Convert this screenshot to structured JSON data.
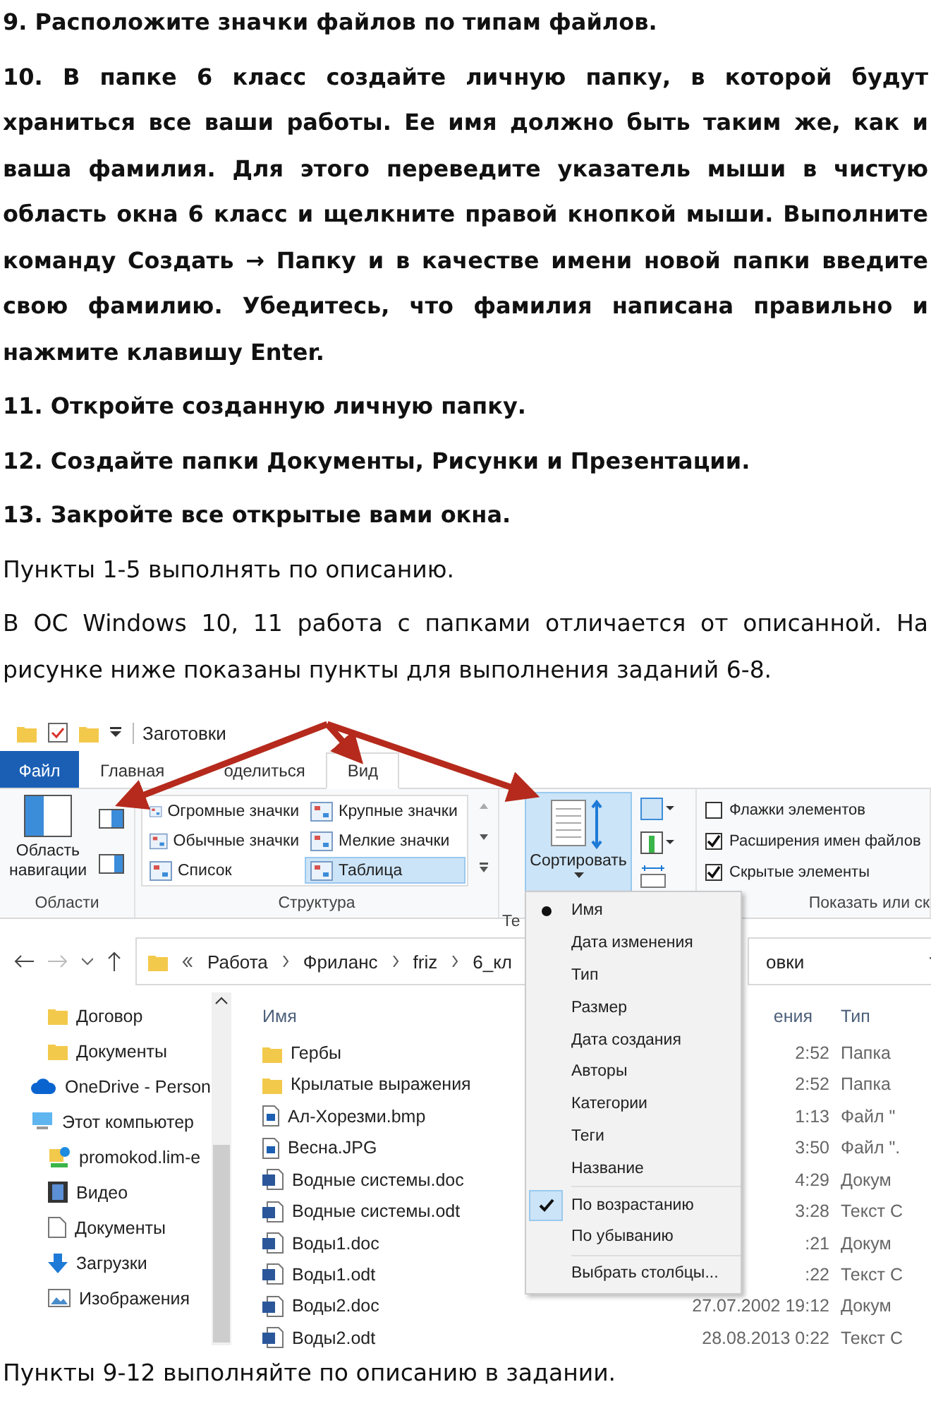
{
  "paragraphs": [
    {
      "kind": "bold",
      "text": "9. Расположите значки файлов по типам файлов."
    },
    {
      "kind": "bold",
      "text": "10. В папке 6 класс создайте личную папку, в которой будут храниться все ваши работы. Ее имя должно быть таким же, как и ваша фамилия. Для этого переведите указатель мыши в чистую область окна 6 класс и щелкните правой кнопкой мыши. Выполните команду Создать → Папку и в качестве имени новой папки введите свою фамилию. Убедитесь, что фамилия написана правильно и нажмите клавишу Enter."
    },
    {
      "kind": "bold",
      "text": "11. Откройте созданную личную папку."
    },
    {
      "kind": "bold",
      "text": "12. Создайте папки Документы, Рисунки и Презентации."
    },
    {
      "kind": "bold",
      "text": "13. Закройте все открытые вами окна."
    },
    {
      "kind": "normal",
      "text": "Пункты 1-5 выполнять по описанию."
    },
    {
      "kind": "normal",
      "text": "В ОС Windows 10, 11 работа с папками отличается от описанной. На рисунке ниже показаны пункты для выполнения заданий 6-8."
    }
  ],
  "explorer": {
    "title": "Заготовки",
    "tabs": [
      {
        "label": "Файл",
        "kind": "file",
        "selected": false
      },
      {
        "label": "Главная",
        "kind": "plain",
        "selected": false
      },
      {
        "label": "оделиться",
        "kind": "plain",
        "selected": false
      },
      {
        "label": "Вид",
        "kind": "plain",
        "selected": true
      }
    ],
    "ribbon": {
      "panes": {
        "button": "Область навигации",
        "label": "Области"
      },
      "layout": {
        "items": [
          {
            "label": "Огромные значки",
            "selected": false
          },
          {
            "label": "Крупные значки",
            "selected": false
          },
          {
            "label": "Обычные значки",
            "selected": false
          },
          {
            "label": "Мелкие значки",
            "selected": false
          },
          {
            "label": "Список",
            "selected": false
          },
          {
            "label": "Таблица",
            "selected": true
          }
        ],
        "label": "Структура"
      },
      "current_label": "Те",
      "sort_button": "Сортировать",
      "show": {
        "items": [
          {
            "label": "Флажки элементов",
            "checked": false
          },
          {
            "label": "Расширения имен файлов",
            "checked": true
          },
          {
            "label": "Скрытые элементы",
            "checked": true
          }
        ],
        "label": "Показать или ск"
      }
    },
    "address": {
      "crumbs": [
        "Работа",
        "Фриланс",
        "friz",
        "6_кл"
      ],
      "search": "овки"
    },
    "nav": [
      {
        "kind": "folder",
        "label": "Договор"
      },
      {
        "kind": "folder",
        "label": "Документы"
      },
      {
        "kind": "cloud",
        "label": "OneDrive - Person"
      },
      {
        "kind": "pc",
        "label": "Этот компьютер",
        "children": [
          {
            "kind": "network",
            "label": "promokod.lim-e"
          },
          {
            "kind": "video",
            "label": "Видео"
          },
          {
            "kind": "docs",
            "label": "Документы"
          },
          {
            "kind": "download",
            "label": "Загрузки"
          },
          {
            "kind": "images",
            "label": "Изображения"
          }
        ]
      }
    ],
    "columns": [
      "Имя",
      "ения",
      "Тип"
    ],
    "rows": [
      {
        "kind": "folder",
        "name": "Гербы",
        "date": "2:52",
        "type": "Папка"
      },
      {
        "kind": "folder",
        "name": "Крылатые выражения",
        "date": "2:52",
        "type": "Папка"
      },
      {
        "kind": "image",
        "name": "Ал-Хорезми.bmp",
        "date": "1:13",
        "type": "Файл \""
      },
      {
        "kind": "image",
        "name": "Весна.JPG",
        "date": "3:50",
        "type": "Файл \"."
      },
      {
        "kind": "word",
        "name": "Водные системы.doc",
        "date": "4:29",
        "type": "Докум"
      },
      {
        "kind": "word",
        "name": "Водные системы.odt",
        "date": "3:28",
        "type": "Текст С"
      },
      {
        "kind": "word",
        "name": "Воды1.doc",
        "date": ":21",
        "type": "Докум"
      },
      {
        "kind": "word",
        "name": "Воды1.odt",
        "date": ":22",
        "type": "Текст С"
      },
      {
        "kind": "word",
        "name": "Воды2.doc",
        "date": "27.07.2002 19:12",
        "type": "Докум"
      },
      {
        "kind": "word",
        "name": "Воды2.odt",
        "date": "28.08.2013 0:22",
        "type": "Текст С"
      }
    ],
    "sort_menu": [
      [
        {
          "label": "Имя",
          "kind": "radio",
          "selected": true
        },
        {
          "label": "Дата изменения",
          "kind": "radio",
          "selected": false
        },
        {
          "label": "Тип",
          "kind": "radio",
          "selected": false
        },
        {
          "label": "Размер",
          "kind": "radio",
          "selected": false
        },
        {
          "label": "Дата создания",
          "kind": "radio",
          "selected": false
        },
        {
          "label": "Авторы",
          "kind": "radio",
          "selected": false
        },
        {
          "label": "Категории",
          "kind": "radio",
          "selected": false
        },
        {
          "label": "Теги",
          "kind": "radio",
          "selected": false
        },
        {
          "label": "Название",
          "kind": "radio",
          "selected": false
        }
      ],
      [
        {
          "label": "По возрастанию",
          "kind": "check",
          "selected": true
        },
        {
          "label": "По убыванию",
          "kind": "check",
          "selected": false
        }
      ],
      [
        {
          "label": "Выбрать столбцы...",
          "kind": "plain"
        }
      ]
    ]
  },
  "footer": "Пункты 9-12 выполняйте по описанию в задании."
}
